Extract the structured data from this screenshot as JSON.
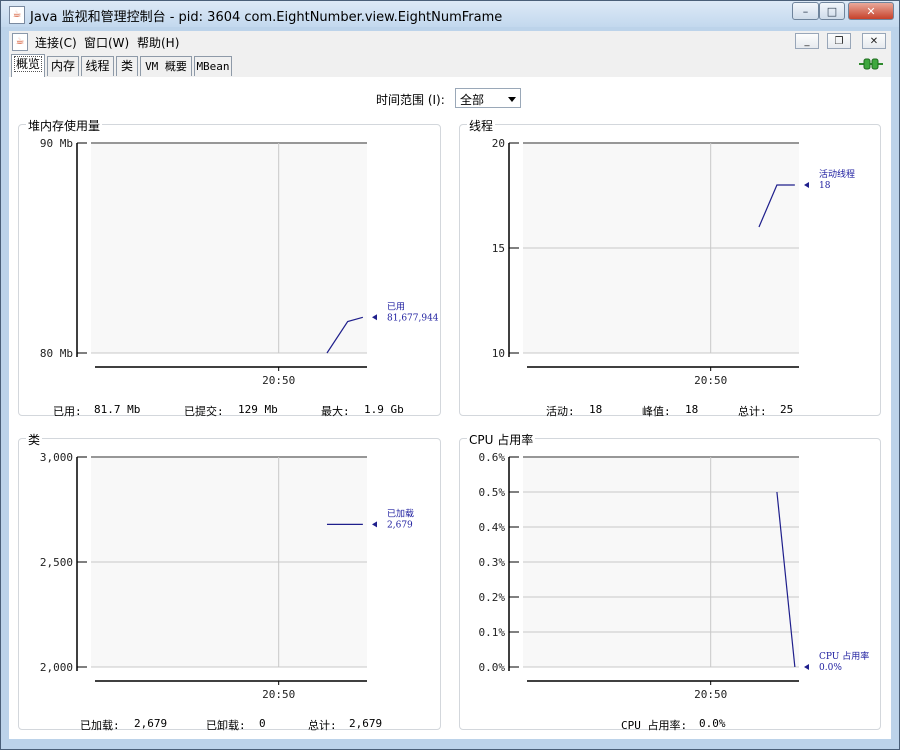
{
  "window": {
    "title": "Java 监视和管理控制台 - pid: 3604 com.EightNumber.view.EightNumFrame",
    "controls": {
      "minimize": "–",
      "maximize": "□",
      "close": "✕"
    }
  },
  "menubar": {
    "items": [
      {
        "label": "连接(C)"
      },
      {
        "label": "窗口(W)"
      },
      {
        "label": "帮助(H)"
      }
    ],
    "inner_controls": {
      "minimize": "_",
      "restore": "❐",
      "close": "✕"
    }
  },
  "tabs": [
    {
      "label": "概览",
      "active": true
    },
    {
      "label": "内存",
      "active": false
    },
    {
      "label": "线程",
      "active": false
    },
    {
      "label": "类",
      "active": false
    },
    {
      "label": "VM 概要",
      "active": false
    },
    {
      "label": "MBean",
      "active": false
    }
  ],
  "connection_icon": "connected-plug-icon",
  "time_range": {
    "label": "时间范围 (I):",
    "selected": "全部"
  },
  "colors": {
    "series": "#1f1f8c",
    "plot_bg": "#f8f8f8",
    "grid": "#c8c8c8"
  },
  "chart_data": [
    {
      "type": "line",
      "title": "堆内存使用量",
      "y_ticks": [
        "90 Mb",
        "80 Mb"
      ],
      "ylim": [
        80,
        90
      ],
      "x_tick": "20:50",
      "series": [
        {
          "name": "已用",
          "values": [
            80.0,
            81.5,
            81.7
          ]
        }
      ],
      "annotation": {
        "name": "已用",
        "value": "81,677,944"
      },
      "stats": {
        "used_label": "已用:",
        "used": "81.7 Mb",
        "committed_label": "已提交:",
        "committed": "129 Mb",
        "max_label": "最大:",
        "max": "1.9 Gb"
      }
    },
    {
      "type": "line",
      "title": "线程",
      "y_ticks": [
        "20",
        "15",
        "10"
      ],
      "ylim": [
        10,
        20
      ],
      "x_tick": "20:50",
      "series": [
        {
          "name": "活动线程",
          "values": [
            16,
            18,
            18
          ]
        }
      ],
      "annotation": {
        "name": "活动线程",
        "value": "18"
      },
      "stats": {
        "live_label": "活动:",
        "live": "18",
        "peak_label": "峰值:",
        "peak": "18",
        "total_label": "总计:",
        "total": "25"
      }
    },
    {
      "type": "line",
      "title": "类",
      "y_ticks": [
        "3,000",
        "2,500",
        "2,000"
      ],
      "ylim": [
        2000,
        3000
      ],
      "x_tick": "20:50",
      "series": [
        {
          "name": "已加载",
          "values": [
            2679,
            2679
          ]
        }
      ],
      "annotation": {
        "name": "已加载",
        "value": "2,679"
      },
      "stats": {
        "loaded_label": "已加载:",
        "loaded": "2,679",
        "unloaded_label": "已卸载:",
        "unloaded": "0",
        "total_label": "总计:",
        "total": "2,679"
      }
    },
    {
      "type": "line",
      "title": "CPU 占用率",
      "y_ticks": [
        "0.6%",
        "0.5%",
        "0.4%",
        "0.3%",
        "0.2%",
        "0.1%",
        "0.0%"
      ],
      "ylim": [
        0,
        0.6
      ],
      "x_tick": "20:50",
      "series": [
        {
          "name": "CPU 占用率",
          "values": [
            0.5,
            0.0
          ]
        }
      ],
      "annotation": {
        "name": "CPU 占用率",
        "value": "0.0%"
      },
      "stats": {
        "cpu_label": "CPU 占用率:",
        "cpu": "0.0%"
      }
    }
  ]
}
